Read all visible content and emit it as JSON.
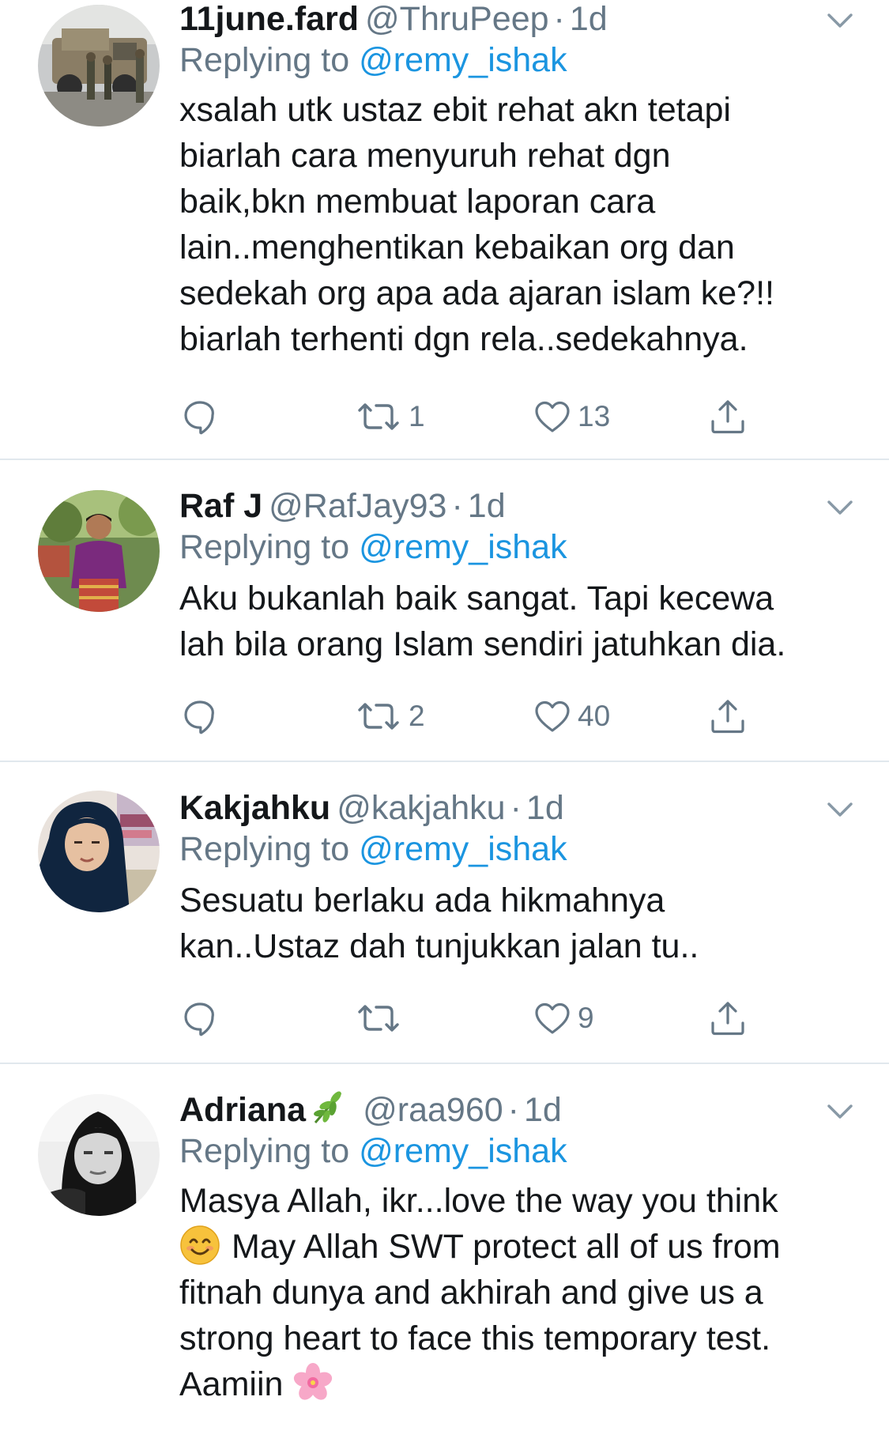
{
  "replying_prefix": "Replying to",
  "tweets": [
    {
      "name": "11june.fard",
      "handle": "@ThruPeep",
      "separator": "·",
      "time": "1d",
      "reply_to": "@remy_ishak",
      "lines": [
        "xsalah utk ustaz ebit rehat akn tetapi",
        "biarlah cara menyuruh rehat dgn",
        "baik,bkn membuat laporan cara",
        "lain..menghentikan kebaikan org dan",
        "sedekah org apa ada ajaran islam ke?!!",
        "biarlah terhenti dgn rela..sedekahnya."
      ],
      "retweets": "1",
      "likes": "13"
    },
    {
      "name": "Raf J",
      "handle": "@RafJay93",
      "separator": "·",
      "time": "1d",
      "reply_to": "@remy_ishak",
      "lines": [
        "Aku bukanlah baik sangat. Tapi kecewa",
        "lah bila orang Islam sendiri jatuhkan dia."
      ],
      "retweets": "2",
      "likes": "40"
    },
    {
      "name": "Kakjahku",
      "handle": "@kakjahku",
      "separator": "·",
      "time": "1d",
      "reply_to": "@remy_ishak",
      "lines": [
        "Sesuatu berlaku ada hikmahnya",
        "kan..Ustaz dah tunjukkan jalan tu.."
      ],
      "retweets": "",
      "likes": "9"
    },
    {
      "name": "Adriana",
      "name_icon": "herb-emoji-icon",
      "handle": "@raa960",
      "separator": "·",
      "time": "1d",
      "reply_to": "@remy_ishak",
      "lines": [
        "Masya Allah, ikr...love the way you think",
        "May Allah SWT protect all of us from",
        "fitnah dunya and akhirah and give us a",
        "strong heart to face this temporary test.",
        "Aamiin"
      ],
      "line_icons": [
        "smiling-face-emoji-icon",
        "cherry-blossom-emoji-icon"
      ]
    }
  ],
  "icons": {
    "reply": "reply-icon",
    "retweet": "retweet-icon",
    "like": "heart-icon",
    "share": "share-icon",
    "more": "chevron-down-icon"
  },
  "colors": {
    "name": "#14171a",
    "muted": "#657786",
    "link": "#1b95e0",
    "divider": "#e1e8ed"
  }
}
